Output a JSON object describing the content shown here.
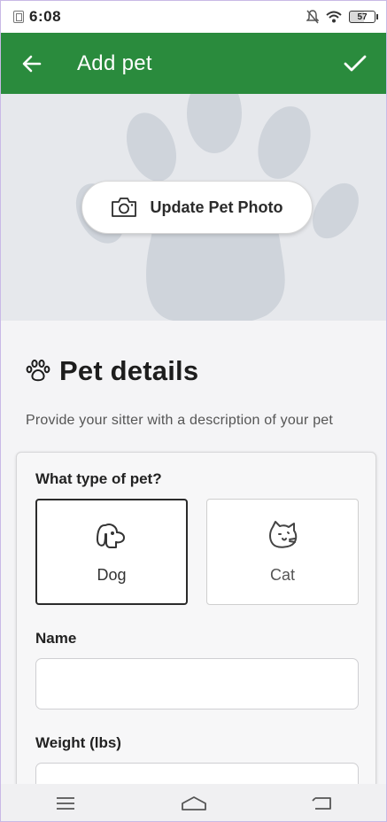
{
  "status_bar": {
    "time": "6:08",
    "battery": "57"
  },
  "app_bar": {
    "title": "Add pet"
  },
  "hero": {
    "update_photo_label": "Update Pet Photo"
  },
  "section": {
    "title": "Pet details",
    "subtitle": "Provide your sitter with a description of your pet"
  },
  "form": {
    "type_question": "What type of pet?",
    "pet_types": [
      {
        "label": "Dog",
        "selected": true
      },
      {
        "label": "Cat",
        "selected": false
      }
    ],
    "name_label": "Name",
    "name_value": "",
    "weight_label": "Weight (lbs)",
    "weight_value": ""
  },
  "colors": {
    "brand_green": "#2a8b3d"
  }
}
